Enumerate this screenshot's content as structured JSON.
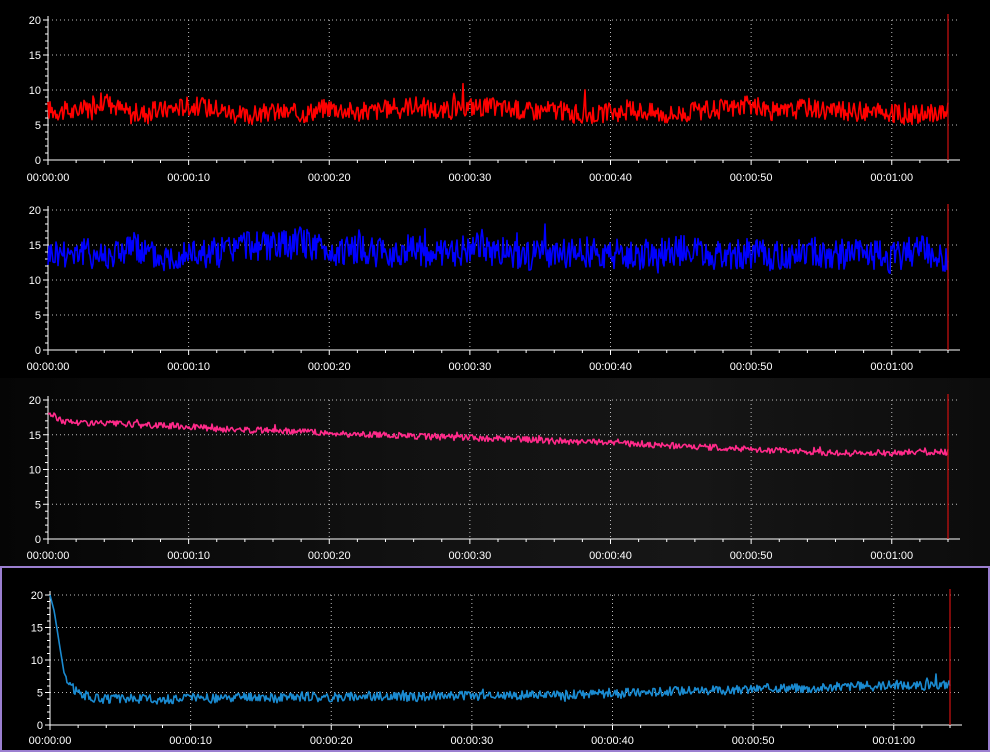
{
  "chart_data": [
    {
      "type": "line",
      "color": "#ff0000",
      "ylim": [
        0,
        20
      ],
      "yticks": [
        "0",
        "5",
        "10",
        "15",
        "20"
      ],
      "xticks": [
        "00:00:00",
        "00:00:10",
        "00:00:20",
        "00:00:30",
        "00:00:40",
        "00:00:50",
        "00:01:00"
      ],
      "xlim_seconds": [
        0,
        64
      ],
      "cursor_seconds": 64,
      "grid": true,
      "series": [
        {
          "x_seconds": [
            0,
            2,
            4,
            6,
            8,
            10,
            12,
            14,
            16,
            18,
            20,
            22,
            24,
            26,
            28,
            30,
            32,
            34,
            36,
            38,
            40,
            42,
            44,
            46,
            48,
            50,
            52,
            54,
            56,
            58,
            60,
            62,
            64
          ],
          "values": [
            7.2,
            6.8,
            8.5,
            6.5,
            7.1,
            7.8,
            7.4,
            6.2,
            6.9,
            6.6,
            7.6,
            6.8,
            7.2,
            7.9,
            6.9,
            7.7,
            7.5,
            7.0,
            7.2,
            6.4,
            6.8,
            7.1,
            6.5,
            6.9,
            7.3,
            7.8,
            6.7,
            7.6,
            7.0,
            6.9,
            6.6,
            6.4,
            7.0
          ]
        }
      ]
    },
    {
      "type": "line",
      "color": "#0000ff",
      "ylim": [
        0,
        20
      ],
      "yticks": [
        "0",
        "5",
        "10",
        "15",
        "20"
      ],
      "xticks": [
        "00:00:00",
        "00:00:10",
        "00:00:20",
        "00:00:30",
        "00:00:40",
        "00:00:50",
        "00:01:00"
      ],
      "xlim_seconds": [
        0,
        64
      ],
      "cursor_seconds": 64,
      "grid": true,
      "series": [
        {
          "x_seconds": [
            0,
            2,
            4,
            6,
            8,
            10,
            12,
            14,
            16,
            18,
            20,
            22,
            24,
            26,
            28,
            30,
            32,
            34,
            36,
            38,
            40,
            42,
            44,
            46,
            48,
            50,
            52,
            54,
            56,
            58,
            60,
            62,
            64
          ],
          "values": [
            13.8,
            14.2,
            13.5,
            14.8,
            13.2,
            14.0,
            13.9,
            15.2,
            14.6,
            15.5,
            14.1,
            14.3,
            13.7,
            14.5,
            13.4,
            14.7,
            14.0,
            13.6,
            13.2,
            14.1,
            13.8,
            13.4,
            14.3,
            14.2,
            13.5,
            13.8,
            13.3,
            14.0,
            13.6,
            13.9,
            13.1,
            14.4,
            13.0
          ]
        }
      ]
    },
    {
      "type": "line",
      "color": "#ff2a8a",
      "ylim": [
        0,
        20
      ],
      "yticks": [
        "0",
        "5",
        "10",
        "15",
        "20"
      ],
      "xticks": [
        "00:00:00",
        "00:00:10",
        "00:00:20",
        "00:00:30",
        "00:00:40",
        "00:00:50",
        "00:01:00"
      ],
      "xlim_seconds": [
        0,
        64
      ],
      "cursor_seconds": 64,
      "grid": true,
      "series": [
        {
          "x_seconds": [
            0,
            1,
            2,
            4,
            6,
            8,
            10,
            12,
            14,
            16,
            18,
            20,
            22,
            24,
            26,
            28,
            30,
            32,
            34,
            36,
            38,
            40,
            42,
            44,
            46,
            48,
            50,
            52,
            54,
            56,
            58,
            60,
            62,
            64
          ],
          "values": [
            18.2,
            17.0,
            16.8,
            16.6,
            16.5,
            16.3,
            16.2,
            15.8,
            15.7,
            15.6,
            15.5,
            15.2,
            15.0,
            15.0,
            14.8,
            14.7,
            14.6,
            14.4,
            14.3,
            14.1,
            14.0,
            13.9,
            13.6,
            13.5,
            13.3,
            13.1,
            12.9,
            12.7,
            12.5,
            12.4,
            12.3,
            12.4,
            12.5,
            12.5
          ]
        }
      ]
    },
    {
      "type": "line",
      "color": "#1a8ad0",
      "ylim": [
        0,
        20
      ],
      "yticks": [
        "0",
        "5",
        "10",
        "15",
        "20"
      ],
      "xticks": [
        "00:00:00",
        "00:00:10",
        "00:00:20",
        "00:00:30",
        "00:00:40",
        "00:00:50",
        "00:01:00"
      ],
      "xlim_seconds": [
        0,
        64
      ],
      "cursor_seconds": 64,
      "grid": true,
      "series": [
        {
          "x_seconds": [
            0,
            0.3,
            0.7,
            1,
            1.5,
            2,
            3,
            4,
            6,
            8,
            10,
            12,
            14,
            16,
            18,
            20,
            22,
            24,
            26,
            28,
            30,
            32,
            34,
            36,
            38,
            40,
            42,
            44,
            46,
            48,
            50,
            52,
            54,
            56,
            58,
            60,
            62,
            64
          ],
          "values": [
            20.0,
            17.5,
            12.0,
            8.0,
            6.0,
            5.0,
            4.2,
            4.0,
            4.1,
            3.9,
            4.2,
            4.0,
            4.3,
            4.1,
            4.4,
            4.2,
            4.5,
            4.4,
            4.3,
            4.6,
            4.5,
            4.4,
            4.7,
            4.6,
            4.8,
            4.9,
            5.0,
            5.2,
            5.4,
            5.3,
            5.5,
            5.8,
            5.6,
            5.9,
            6.0,
            6.2,
            6.0,
            6.3
          ]
        }
      ]
    }
  ]
}
